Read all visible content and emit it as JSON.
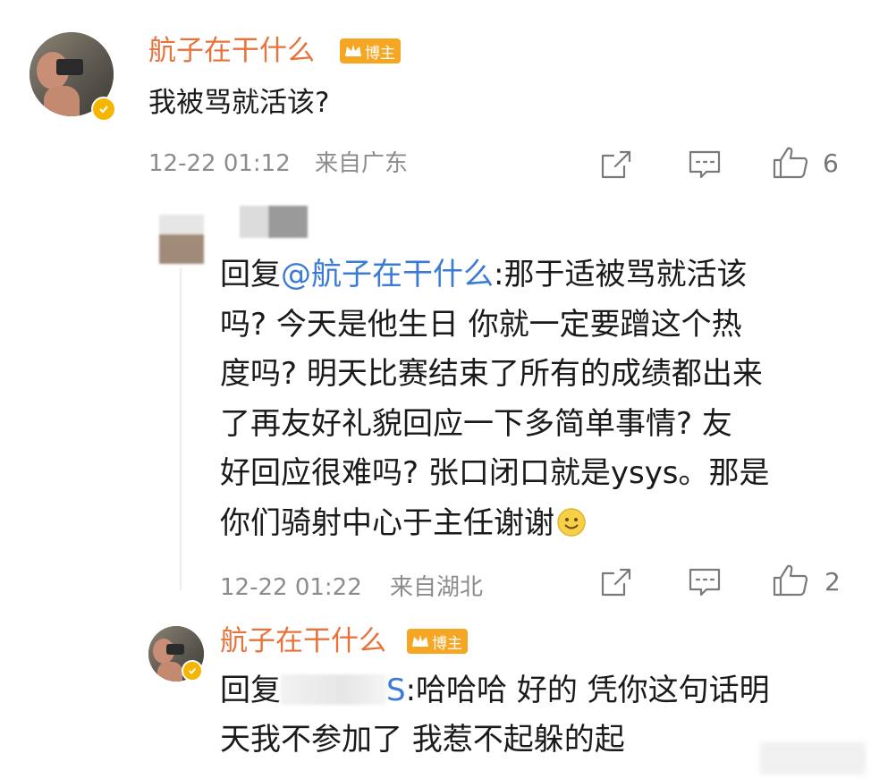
{
  "comment": {
    "username": "航子在干什么",
    "badge": "博主",
    "text": "我被骂就活该?",
    "timestamp": "12-22 01:12",
    "location": "来自广东",
    "like_count": "6"
  },
  "reply": {
    "prefix": "回复",
    "mention": "@航子在干什么",
    "lines": [
      ":那于适被骂就活该",
      "吗? 今天是他生日 你就一定要蹭这个热",
      "度吗? 明天比赛结束了所有的成绩都出来",
      "了再友好礼貌回应一下多简单事情? 友",
      "好回应很难吗? 张口闭口就是ysys。那是",
      "你们骑射中心于主任谢谢"
    ],
    "timestamp": "12-22 01:22",
    "location": "来自湖北",
    "like_count": "2"
  },
  "author_reply": {
    "username": "航子在干什么",
    "badge": "博主",
    "prefix": "回复",
    "redacted_suffix": "S",
    "line1": ":哈哈哈 好的 凭你这句话明",
    "line2": "天我不参加了 我惹不起躲的起"
  },
  "icons": [
    "share-icon",
    "comment-icon",
    "like-icon",
    "verified-icon",
    "smile-emoji-icon"
  ],
  "colors": {
    "username": "#e8733a",
    "mention": "#3b7bd6",
    "badge": "#f5a623",
    "meta": "#8c8c8c"
  }
}
